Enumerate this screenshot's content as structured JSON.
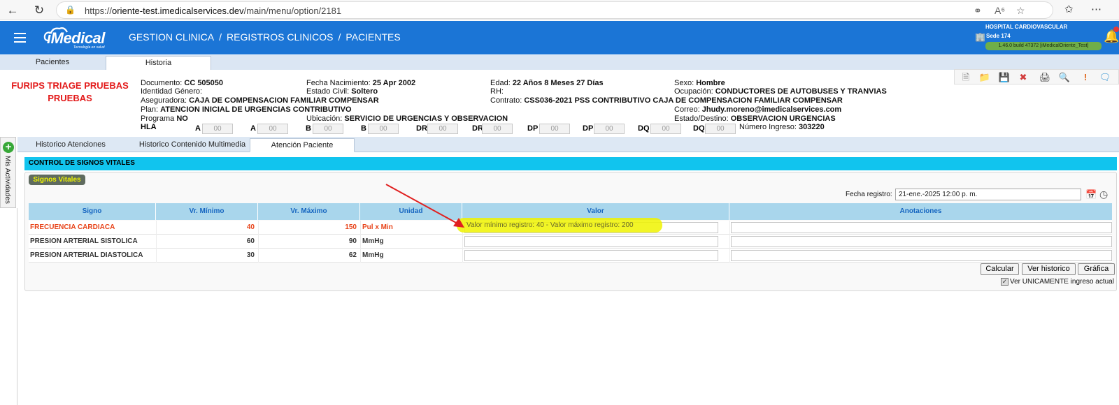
{
  "browser": {
    "url_prefix": "https://",
    "url_host": "oriente-test.imedicalservices.dev",
    "url_path": "/main/menu/option/2181"
  },
  "header": {
    "logo_text": "iMedical",
    "logo_sub": "Tecnología en salud",
    "breadcrumb": [
      "GESTION CLINICA",
      "REGISTROS CLINICOS",
      "PACIENTES"
    ],
    "sep": "/",
    "hospital": "HOSPITAL CARDIOVASCULAR",
    "sede": "Sede 174",
    "build": "1.46.0 build 47372 [iMedicalOriente_Test]"
  },
  "top_tabs": [
    "Pacientes",
    "Historia"
  ],
  "patient": {
    "name_line1": "FURIPS TRIAGE PRUEBAS",
    "name_line2": "PRUEBAS",
    "documento_label": "Documento:",
    "documento": "CC 505050",
    "fecha_nac_label": "Fecha Nacimiento:",
    "fecha_nac": "25 Apr 2002",
    "edad_label": "Edad:",
    "edad": "22 Años 8 Meses 27 Días",
    "sexo_label": "Sexo:",
    "sexo": "Hombre",
    "identidad_label": "Identidad Género:",
    "estado_civil_label": "Estado Civil:",
    "estado_civil": "Soltero",
    "rh_label": "RH:",
    "ocupacion_label": "Ocupación:",
    "ocupacion": "CONDUCTORES DE AUTOBUSES Y TRANVIAS",
    "aseguradora_label": "Aseguradora:",
    "aseguradora": "CAJA DE COMPENSACION FAMILIAR COMPENSAR",
    "contrato_label": "Contrato:",
    "contrato": "CSS036-2021 PSS CONTRIBUTIVO CAJA DE COMPENSACION FAMILIAR COMPENSAR",
    "plan_label": "Plan:",
    "plan": "ATENCION INICIAL DE URGENCIAS CONTRIBUTIVO",
    "correo_label": "Correo:",
    "correo": "Jhudy.moreno@imedicalservices.com",
    "programa_label": "Programa",
    "programa": "NO",
    "ubicacion_label": "Ubicación:",
    "ubicacion": "SERVICIO DE URGENCIAS Y OBSERVACION",
    "estado_destino_label": "Estado/Destino:",
    "estado_destino": "OBSERVACION URGENCIAS",
    "hla_label": "HLA",
    "hla_fields": [
      {
        "label": "A",
        "value": "00"
      },
      {
        "label": "A",
        "value": "00"
      },
      {
        "label": "B",
        "value": "00"
      },
      {
        "label": "B",
        "value": "00"
      },
      {
        "label": "DR",
        "value": "00"
      },
      {
        "label": "DR",
        "value": "00"
      },
      {
        "label": "DP",
        "value": "00"
      },
      {
        "label": "DP",
        "value": "00"
      },
      {
        "label": "DQ",
        "value": "00"
      },
      {
        "label": "DQ",
        "value": "00"
      }
    ],
    "ingreso_label": "Número Ingreso:",
    "ingreso": "303220"
  },
  "side": {
    "label": "Mis Actividades",
    "plus": "+"
  },
  "inner_tabs": [
    "Historico Atenciones",
    "Historico Contenido Multimedia",
    "Atención Paciente"
  ],
  "section": {
    "title": "CONTROL DE SIGNOS VITALES",
    "badge": "Signos Vitales",
    "fecha_label": "Fecha registro:",
    "fecha_value": "21-ene.-2025 12:00 p. m."
  },
  "table": {
    "headers": [
      "Signo",
      "Vr. Mínimo",
      "Vr. Máximo",
      "Unidad",
      "Valor",
      "Anotaciones"
    ],
    "rows": [
      {
        "signo": "FRECUENCIA CARDIACA",
        "min": "40",
        "max": "150",
        "unidad": "Pul x Min",
        "alert": true
      },
      {
        "signo": "PRESION ARTERIAL SISTOLICA",
        "min": "60",
        "max": "90",
        "unidad": "MmHg",
        "alert": false
      },
      {
        "signo": "PRESION ARTERIAL DIASTOLICA",
        "min": "30",
        "max": "62",
        "unidad": "MmHg",
        "alert": false
      }
    ],
    "tooltip": "Valor mínimo registro: 40 - Valor máximo registro: 200"
  },
  "buttons": {
    "calcular": "Calcular",
    "ver_historico": "Ver historico",
    "grafica": "Gráfica"
  },
  "checkbox": {
    "label": "Ver UNICAMENTE ingreso actual",
    "checked": true
  },
  "colors": {
    "header_blue": "#1b75d6",
    "section_cyan": "#11c4ee",
    "alert_red": "#e8441a",
    "highlight_yellow": "#f0f300",
    "badge_text": "#eef400"
  },
  "icons": [
    "back-icon",
    "refresh-icon",
    "lock-icon",
    "key-icon",
    "read-aloud-icon",
    "star-icon",
    "favorites-icon",
    "more-icon",
    "hamburger-icon",
    "bell-icon",
    "building-icon",
    "new-doc-icon",
    "folder-icon",
    "save-icon",
    "delete-icon",
    "print-icon",
    "preview-icon",
    "alert-icon",
    "comment-icon",
    "calendar-icon",
    "clock-icon"
  ]
}
